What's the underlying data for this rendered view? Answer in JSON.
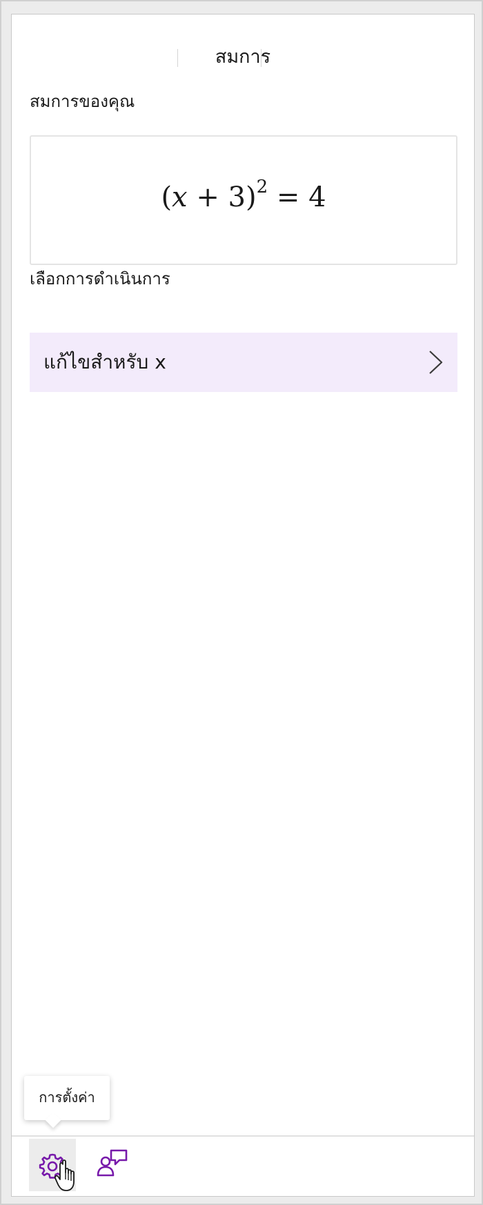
{
  "header": {
    "title": "สมการ"
  },
  "equation_section": {
    "label": "สมการของคุณ",
    "equation": {
      "open": "(",
      "variable": "x",
      "middle": " + 3)",
      "exponent": "2",
      "rest": " = 4"
    }
  },
  "action_section": {
    "label": "เลือกการดำเนินการ",
    "actions": [
      {
        "label": "แก้ไขสำหรับ x"
      }
    ]
  },
  "bottom_bar": {
    "settings_icon": "gear-icon",
    "feedback_icon": "feedback-icon",
    "tooltip": "การตั้งค่า"
  },
  "colors": {
    "accent": "#7719aa",
    "action_bg": "#f3ebfb"
  }
}
